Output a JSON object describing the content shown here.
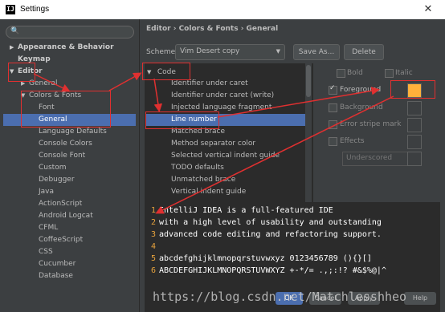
{
  "window": {
    "title": "Settings",
    "app_icon": "intellij-icon",
    "close_glyph": "✕"
  },
  "search": {
    "icon": "search-icon",
    "glyph": "🔍",
    "placeholder": ""
  },
  "tree": {
    "items": [
      {
        "label": "Appearance & Behavior",
        "expanded": false
      },
      {
        "label": "Keymap",
        "expanded": null
      },
      {
        "label": "Editor",
        "expanded": true
      },
      {
        "label": "General",
        "expanded": false
      },
      {
        "label": "Colors & Fonts",
        "expanded": true
      },
      {
        "label": "Font"
      },
      {
        "label": "General",
        "selected": true
      },
      {
        "label": "Language Defaults"
      },
      {
        "label": "Console Colors"
      },
      {
        "label": "Console Font"
      },
      {
        "label": "Custom"
      },
      {
        "label": "Debugger"
      },
      {
        "label": "Java"
      },
      {
        "label": "ActionScript"
      },
      {
        "label": "Android Logcat"
      },
      {
        "label": "CFML"
      },
      {
        "label": "CoffeeScript"
      },
      {
        "label": "CSS"
      },
      {
        "label": "Cucumber"
      },
      {
        "label": "Database"
      }
    ]
  },
  "breadcrumb": "Editor › Colors & Fonts › General",
  "scheme": {
    "label": "Scheme:",
    "value": "Vim Desert copy"
  },
  "buttons": {
    "save_as": "Save As...",
    "delete": "Delete",
    "ok": "OK",
    "cancel": "Cancel",
    "apply": "Apply",
    "help": "Help"
  },
  "code_list": {
    "header": "Code",
    "items": [
      {
        "label": "Identifier under caret"
      },
      {
        "label": "Identifier under caret (write)"
      },
      {
        "label": "Injected language fragment"
      },
      {
        "label": "Line number",
        "selected": true
      },
      {
        "label": "Matched brace"
      },
      {
        "label": "Method separator color"
      },
      {
        "label": "Selected vertical indent guide"
      },
      {
        "label": "TODO defaults"
      },
      {
        "label": "Unmatched brace"
      },
      {
        "label": "Vertical indent guide"
      }
    ]
  },
  "attributes": {
    "bold": "Bold",
    "italic": "Italic",
    "foreground": "Foreground",
    "background": "Background",
    "error_stripe": "Error stripe mark",
    "effects": "Effects",
    "effect_type": "Underscored"
  },
  "colors": {
    "foreground": "#ffb13b",
    "selection": "#4b6eaf",
    "line_number": "#e8a33d",
    "annotation": "#e03030"
  },
  "preview": {
    "lines": [
      {
        "num": "1",
        "text": "IntelliJ IDEA is a full-featured IDE"
      },
      {
        "num": "2",
        "text": "with a high level of usability and outstanding"
      },
      {
        "num": "3",
        "text": "advanced code editing and refactoring support."
      },
      {
        "num": "4",
        "text": ""
      },
      {
        "num": "5",
        "text": "abcdefghijklmnopqrstuvwxyz 0123456789 (){}[]"
      },
      {
        "num": "6",
        "text": "ABCDEFGHIJKLMNOPQRSTUVWXYZ +-*/= .,;:!? #&$%@|^"
      }
    ]
  },
  "watermark": "https://blog.csdn.net/Matchlesshheo"
}
